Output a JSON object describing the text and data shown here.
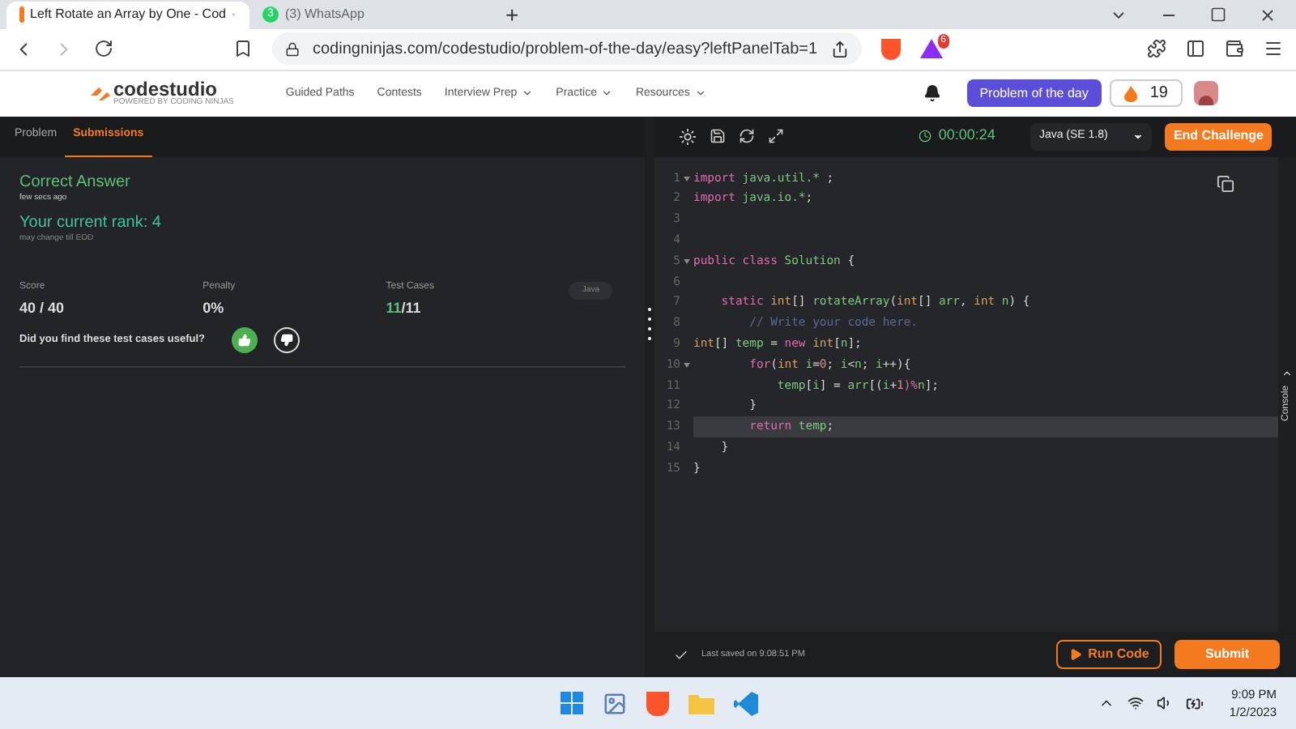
{
  "browser": {
    "tabs": [
      {
        "title": "Left Rotate an Array by One - Cod",
        "selected": true,
        "kind": "site"
      },
      {
        "title": "(3) WhatsApp",
        "selected": false,
        "kind": "chat",
        "badge": "3"
      }
    ],
    "new_tab": "+",
    "url": "codingninjas.com/codestudio/problem-of-the-day/easy?leftPanelTab=1",
    "extension_badge": "6"
  },
  "site_nav": {
    "logo": "codestudio",
    "logo_sub": "POWERED BY CODING NINJAS",
    "links": [
      {
        "label": "Guided Paths",
        "dropdown": false
      },
      {
        "label": "Contests",
        "dropdown": false
      },
      {
        "label": "Interview Prep",
        "dropdown": true
      },
      {
        "label": "Practice",
        "dropdown": true
      },
      {
        "label": "Resources",
        "dropdown": true
      }
    ],
    "potd_button": "Problem of the day",
    "streak": "19"
  },
  "left_panel": {
    "tabs": [
      {
        "label": "Problem",
        "selected": false
      },
      {
        "label": "Submissions",
        "selected": true
      }
    ],
    "result": "Correct Answer",
    "time": "few secs ago",
    "rank": "Your current rank: 4",
    "rank_note": "may change till EOD",
    "stats": [
      {
        "label": "Score",
        "value": "40 / 40"
      },
      {
        "label": "Penalty",
        "value": "0%"
      },
      {
        "label": "Test Cases",
        "passed": "11",
        "total": "/11"
      }
    ],
    "language_tag": "Java",
    "feedback_question": "Did you find these test cases useful?",
    "liked": true
  },
  "editor": {
    "timer": "00:00:24",
    "language": "Java (SE 1.8)",
    "end_button": "End Challenge",
    "lines": [
      {
        "number": "1",
        "fold": true,
        "highlighted": false,
        "tokens": [
          {
            "text": "import",
            "kind": "keyword"
          },
          {
            "text": " java.util.* ",
            "kind": "name"
          },
          {
            "text": ";",
            "kind": "plain"
          }
        ]
      },
      {
        "number": "2",
        "fold": false,
        "highlighted": false,
        "tokens": [
          {
            "text": "import",
            "kind": "keyword"
          },
          {
            "text": " java.io.*",
            "kind": "name"
          },
          {
            "text": ";",
            "kind": "plain"
          }
        ]
      },
      {
        "number": "3",
        "fold": false,
        "highlighted": false
      },
      {
        "number": "4",
        "fold": false,
        "highlighted": false
      },
      {
        "number": "5",
        "fold": true,
        "highlighted": false,
        "tokens": [
          {
            "text": "public class",
            "kind": "keyword"
          },
          {
            "text": " Solution",
            "kind": "name"
          },
          {
            "text": " {",
            "kind": "plain"
          }
        ]
      },
      {
        "number": "6",
        "fold": false,
        "highlighted": false
      },
      {
        "number": "7",
        "fold": false,
        "highlighted": false,
        "tokens": [
          {
            "text": "    static",
            "kind": "keyword"
          },
          {
            "text": " int",
            "kind": "type"
          },
          {
            "text": "[] ",
            "kind": "plain"
          },
          {
            "text": "rotateArray",
            "kind": "name"
          },
          {
            "text": "(",
            "kind": "plain"
          },
          {
            "text": "int",
            "kind": "type"
          },
          {
            "text": "[] ",
            "kind": "plain"
          },
          {
            "text": "arr",
            "kind": "name"
          },
          {
            "text": ", ",
            "kind": "plain"
          },
          {
            "text": "int",
            "kind": "type"
          },
          {
            "text": " n",
            "kind": "name"
          },
          {
            "text": ") {",
            "kind": "plain"
          }
        ]
      },
      {
        "number": "8",
        "fold": false,
        "highlighted": false,
        "tokens": [
          {
            "text": "        // Write your code here.",
            "kind": "comment"
          }
        ]
      },
      {
        "number": "9",
        "fold": false,
        "highlighted": false,
        "tokens": [
          {
            "text": "int",
            "kind": "type"
          },
          {
            "text": "[] ",
            "kind": "plain"
          },
          {
            "text": "temp",
            "kind": "name"
          },
          {
            "text": " = ",
            "kind": "plain"
          },
          {
            "text": "new",
            "kind": "keyword"
          },
          {
            "text": " int",
            "kind": "type"
          },
          {
            "text": "[",
            "kind": "plain"
          },
          {
            "text": "n",
            "kind": "name"
          },
          {
            "text": "];",
            "kind": "plain"
          }
        ]
      },
      {
        "number": "10",
        "fold": true,
        "highlighted": false,
        "tokens": [
          {
            "text": "        for",
            "kind": "keyword"
          },
          {
            "text": "(",
            "kind": "plain"
          },
          {
            "text": "int",
            "kind": "type"
          },
          {
            "text": " i",
            "kind": "name"
          },
          {
            "text": "=",
            "kind": "plain"
          },
          {
            "text": "0",
            "kind": "number"
          },
          {
            "text": "; ",
            "kind": "plain"
          },
          {
            "text": "i",
            "kind": "name"
          },
          {
            "text": "<",
            "kind": "plain"
          },
          {
            "text": "n",
            "kind": "name"
          },
          {
            "text": "; ",
            "kind": "plain"
          },
          {
            "text": "i",
            "kind": "name"
          },
          {
            "text": "++){",
            "kind": "plain"
          }
        ]
      },
      {
        "number": "11",
        "fold": false,
        "highlighted": false,
        "tokens": [
          {
            "text": "            temp",
            "kind": "name"
          },
          {
            "text": "[",
            "kind": "plain"
          },
          {
            "text": "i",
            "kind": "name"
          },
          {
            "text": "] = ",
            "kind": "plain"
          },
          {
            "text": "arr",
            "kind": "name"
          },
          {
            "text": "[(",
            "kind": "plain"
          },
          {
            "text": "i",
            "kind": "name"
          },
          {
            "text": "+",
            "kind": "plain"
          },
          {
            "text": "1",
            "kind": "number"
          },
          {
            "text": ")%",
            "kind": "keyword"
          },
          {
            "text": "n",
            "kind": "name"
          },
          {
            "text": "];",
            "kind": "plain"
          }
        ]
      },
      {
        "number": "12",
        "fold": false,
        "highlighted": false,
        "tokens": [
          {
            "text": "        }",
            "kind": "plain"
          }
        ]
      },
      {
        "number": "13",
        "fold": false,
        "highlighted": true,
        "tokens": [
          {
            "text": "        return",
            "kind": "keyword"
          },
          {
            "text": " temp",
            "kind": "name"
          },
          {
            "text": ";",
            "kind": "plain"
          }
        ]
      },
      {
        "number": "14",
        "fold": false,
        "highlighted": false,
        "tokens": [
          {
            "text": "    }",
            "kind": "plain"
          }
        ]
      },
      {
        "number": "15",
        "fold": false,
        "highlighted": false,
        "tokens": [
          {
            "text": "}",
            "kind": "plain"
          }
        ]
      }
    ],
    "console_label": "Console",
    "saved_note": "Last saved on 9:08:51 PM",
    "run_button": "Run Code",
    "submit_button": "Submit"
  },
  "taskbar": {
    "time": "9:09 PM",
    "date": "1/2/2023"
  }
}
